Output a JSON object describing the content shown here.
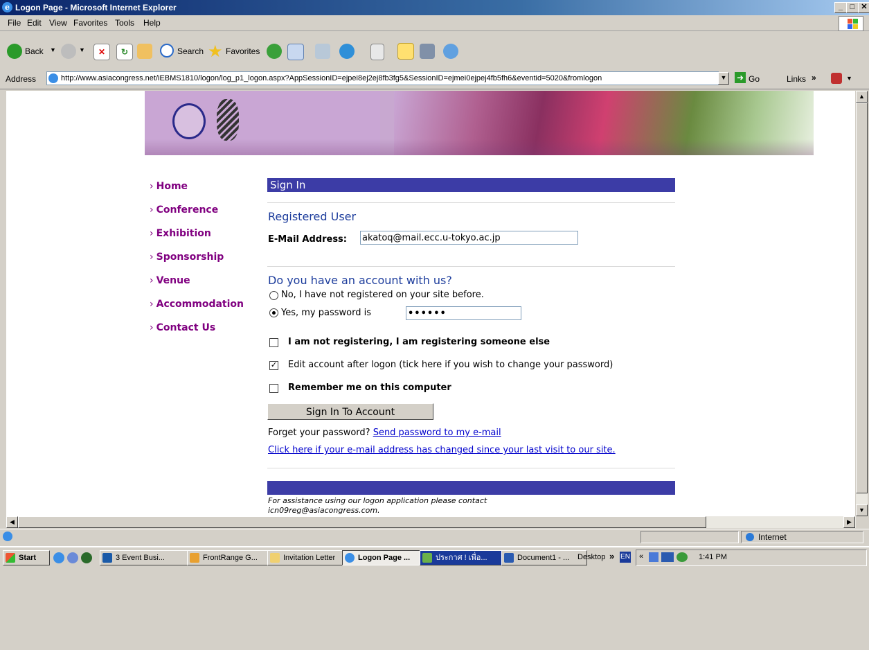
{
  "window": {
    "title": "Logon Page - Microsoft Internet Explorer",
    "min": "_",
    "max": "□",
    "close": "✕"
  },
  "menu": [
    "File",
    "Edit",
    "View",
    "Favorites",
    "Tools",
    "Help"
  ],
  "toolbar": {
    "back": "Back",
    "search": "Search",
    "favorites": "Favorites"
  },
  "address": {
    "label": "Address",
    "url": "http://www.asiacongress.net/iEBMS1810/logon/log_p1_logon.aspx?AppSessionID=ejpei8ej2ej8fb3fg5&SessionID=ejmei0ejpej4fb5fh6&eventid=5020&fromlogon",
    "go": "Go",
    "links": "Links"
  },
  "nav": [
    "Home",
    "Conference",
    "Exhibition",
    "Sponsorship",
    "Venue",
    "Accommodation",
    "Contact Us"
  ],
  "nav_arrow": "›",
  "signin": {
    "title": "Sign In",
    "registered_heading": "Registered User",
    "email_label": "E-Mail Address:",
    "email_value": "akatoq@mail.ecc.u-tokyo.ac.jp",
    "account_heading": "Do you have an account with us?",
    "radio_no": "No, I have not registered on your site before.",
    "radio_yes": "Yes, my password is",
    "password_value": "••••••",
    "chk_someone_else": "I am not registering, I am registering someone else",
    "chk_edit": "Edit account after logon (tick here if you wish to change your password)",
    "chk_remember": "Remember me on this computer",
    "button": "Sign In To Account",
    "forget_text": "Forget your password?",
    "forget_link": "Send password to my e-mail",
    "changed_link": "Click here if your e-mail address has changed since your last visit to our site.",
    "assistance": "For assistance using our logon application please contact",
    "assistance_email": "icn09reg@asiacongress.com."
  },
  "status": {
    "zone": "Internet"
  },
  "taskbar": {
    "start": "Start",
    "tasks": [
      "3 Event Busi...",
      "FrontRange G...",
      "Invitation Letter",
      "Logon Page ...",
      "ประกาศ ! เพื่อ...",
      "Document1 - ..."
    ],
    "desktop": "Desktop",
    "lang": "EN",
    "clock": "1:41 PM"
  },
  "colors": {
    "signin_bar": "#3c3ca6",
    "nav_link": "#800080",
    "heading": "#1c3c9c",
    "link": "#0000cc"
  }
}
